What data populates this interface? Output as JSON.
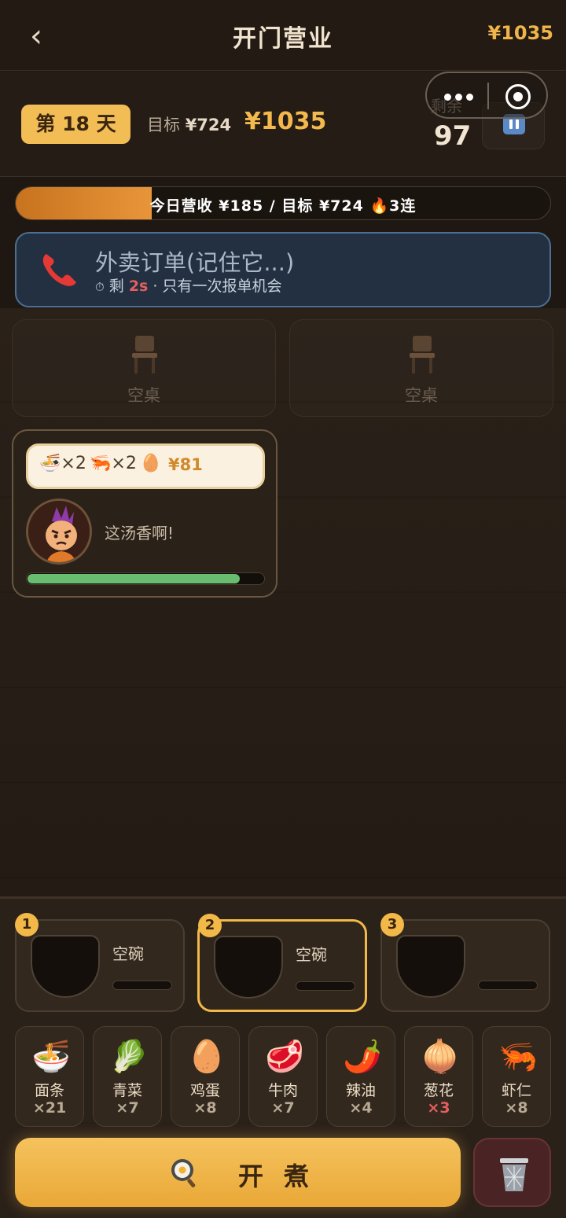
{
  "nav": {
    "back_glyph": "‹",
    "title": "开门营业",
    "money": "¥1035"
  },
  "status": {
    "day": "第 18 天",
    "goal_label": "目标",
    "goal_value": "¥724",
    "money": "¥1035",
    "remaining_label": "剩余",
    "remaining_value": "97",
    "pause_icon": "pause-icon"
  },
  "revenue": {
    "text": "今日营收 ¥185 / 目标 ¥724 🔥3连",
    "progress": 0.255,
    "fill_color": "#e8953a"
  },
  "delivery": {
    "title": "外卖订单(记住它...)",
    "timer_glyph": "⏱",
    "remaining_prefix": "剩",
    "remaining_seconds": "2s",
    "note": "· 只有一次报单机会",
    "icon": "phone-icon"
  },
  "tables": [
    {
      "label": "空桌"
    },
    {
      "label": "空桌"
    }
  ],
  "customer": {
    "order": [
      {
        "icon": "🍜",
        "qty": "×2"
      },
      {
        "icon": "🦐",
        "qty": "×2"
      },
      {
        "icon": "🥚",
        "qty": ""
      }
    ],
    "price": "¥81",
    "speech": "这汤香啊!",
    "patience": 0.9,
    "patience_color": "#69bd6f"
  },
  "bowls": [
    {
      "num": "1",
      "label": "空碗",
      "active": false
    },
    {
      "num": "2",
      "label": "空碗",
      "active": true
    },
    {
      "num": "3",
      "label": "",
      "active": false
    }
  ],
  "ingredients": [
    {
      "icon": "🍜",
      "name": "面条",
      "count": "×21",
      "low": false
    },
    {
      "icon": "🥬",
      "name": "青菜",
      "count": "×7",
      "low": false
    },
    {
      "icon": "🥚",
      "name": "鸡蛋",
      "count": "×8",
      "low": false
    },
    {
      "icon": "🥩",
      "name": "牛肉",
      "count": "×7",
      "low": false
    },
    {
      "icon": "🌶️",
      "name": "辣油",
      "count": "×4",
      "low": false
    },
    {
      "icon": "🧅",
      "name": "葱花",
      "count": "×3",
      "low": true
    },
    {
      "icon": "🦐",
      "name": "虾仁",
      "count": "×8",
      "low": false
    }
  ],
  "actions": {
    "cook_label": "开煮",
    "cook_icon": "frying-pan-icon",
    "trash_icon": "trash-icon"
  },
  "colors": {
    "accent": "#f2b848",
    "money": "#f3b94d",
    "danger": "#e35f5f"
  }
}
